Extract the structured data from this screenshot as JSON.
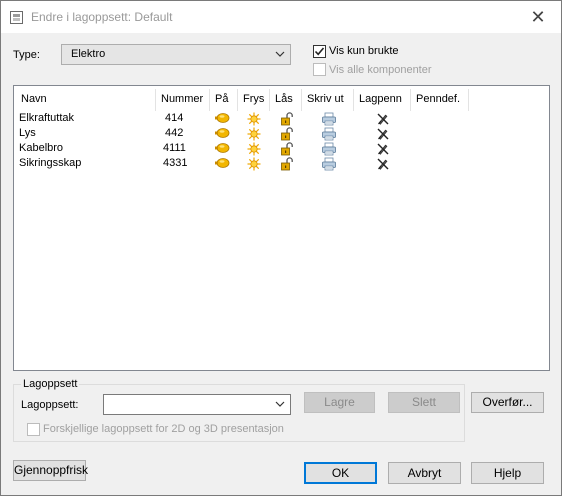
{
  "window": {
    "title": "Endre i lagoppsett: Default",
    "close_glyph": "✕"
  },
  "type_label": "Type:",
  "type_value": "Elektro",
  "checkboxes": {
    "vis_kun_brukte": {
      "label": "Vis kun brukte",
      "checked": true
    },
    "vis_alle_komponenter": {
      "label": "Vis alle komponenter",
      "checked": false,
      "enabled": false
    }
  },
  "columns": [
    "Navn",
    "Nummer",
    "På",
    "Frys",
    "Lås",
    "Skriv ut",
    "Lagpenn",
    "Penndef."
  ],
  "rows": [
    {
      "name": "Elkraftuttak",
      "number": "414",
      "icons": [
        "bulb-on-icon",
        "sun-icon",
        "unlocked-padlock-icon",
        "printer-icon",
        "pen-disabled-icon"
      ]
    },
    {
      "name": "Lys",
      "number": "442",
      "icons": [
        "bulb-on-icon",
        "sun-icon",
        "unlocked-padlock-icon",
        "printer-icon",
        "pen-disabled-icon"
      ]
    },
    {
      "name": "Kabelbro",
      "number": "4111",
      "icons": [
        "bulb-on-icon",
        "sun-icon",
        "unlocked-padlock-icon",
        "printer-icon",
        "pen-disabled-icon"
      ]
    },
    {
      "name": "Sikringsskap",
      "number": "4331",
      "icons": [
        "bulb-on-icon",
        "sun-icon",
        "unlocked-padlock-icon",
        "printer-icon",
        "pen-disabled-icon"
      ]
    }
  ],
  "lagoppsett_group": {
    "title": "Lagoppsett",
    "field_label": "Lagoppsett:",
    "field_value": "",
    "lagre_label": "Lagre",
    "slett_label": "Slett",
    "checkbox_label": "Forskjellige lagoppsett for 2D og 3D presentasjon"
  },
  "buttons": {
    "overfor": "Overfør...",
    "gjennoppfrisk": "Gjennoppfrisk",
    "ok": "OK",
    "avbryt": "Avbryt",
    "hjelp": "Hjelp"
  },
  "colors": {
    "accent": "#0078d7",
    "bulb": "#f0b400",
    "sun": "#f5b800"
  }
}
